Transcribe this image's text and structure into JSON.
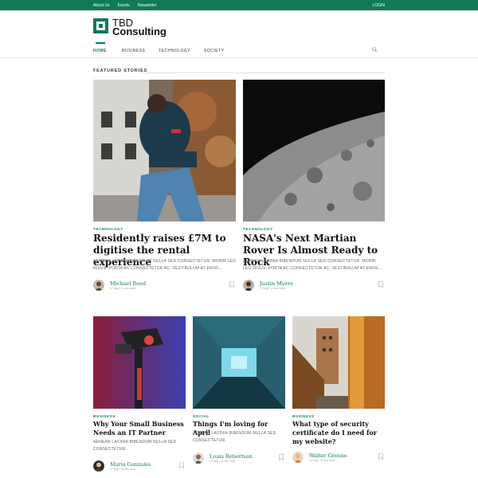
{
  "topbar": {
    "links": [
      "About Us",
      "Events",
      "Newsletter"
    ],
    "login": "LOGIN"
  },
  "logo": {
    "line1": "TBD",
    "line2": "Consulting"
  },
  "nav": {
    "items": [
      "HOME",
      "BUSINESS",
      "TECHNOLOGY",
      "SOCIETY"
    ],
    "active": "HOME"
  },
  "section": {
    "heading": "FEATURED STORIES"
  },
  "colors": {
    "brand": "#0f7a57"
  },
  "stories": [
    {
      "category": "TECHNOLOGY",
      "title": "Residently raises £7M to digitise the rental experience",
      "excerpt": "AENEAN LACINIA BIBENDUM NULLA SED CONSECTETUR. MORBI LEO RISUS, PORTA AC CONSECTETUR AC, VESTIBULUM AT EROS...",
      "author": "Michael Reed",
      "meta": "17 Aug / 11 min read",
      "image": "man-phone"
    },
    {
      "category": "TECHNOLOGY",
      "title": "NASA's Next Martian Rover Is Almost Ready to Rock",
      "excerpt": "AENEAN LACINIA BIBENDUM NULLA SED CONSECTETUR. MORBI LEO RISUS, PORTA AC CONSECTETUR AC, VESTIBULUM AT EROS...",
      "author": "Justin Myers",
      "meta": "17 Aug / 11 min read",
      "image": "moon-surface"
    },
    {
      "category": "BUSINESS",
      "title": "Why Your Small Business Needs an IT Partner",
      "excerpt": "AENEAN LACINIA BIBENDUM NULLA SED CONSECTETUR.",
      "author": "Maria Gonzales",
      "meta": "17 Aug / 11 min read",
      "image": "camera-gimbal"
    },
    {
      "category": "SOCIAL",
      "title": "Things I'm loving for April",
      "excerpt": "AENEAN LACINIA BIBENDUM NULLA SED CONSECTETUR.",
      "author": "Louis Robertson",
      "meta": "17 Aug / 11 min read",
      "image": "tunnel"
    },
    {
      "category": "BUSINESS",
      "title": "What type of security certificate do I need for my website?",
      "excerpt": "",
      "author": "Walter Greene",
      "meta": "17 Aug / 11 min read",
      "image": "buildings-sunset"
    }
  ]
}
